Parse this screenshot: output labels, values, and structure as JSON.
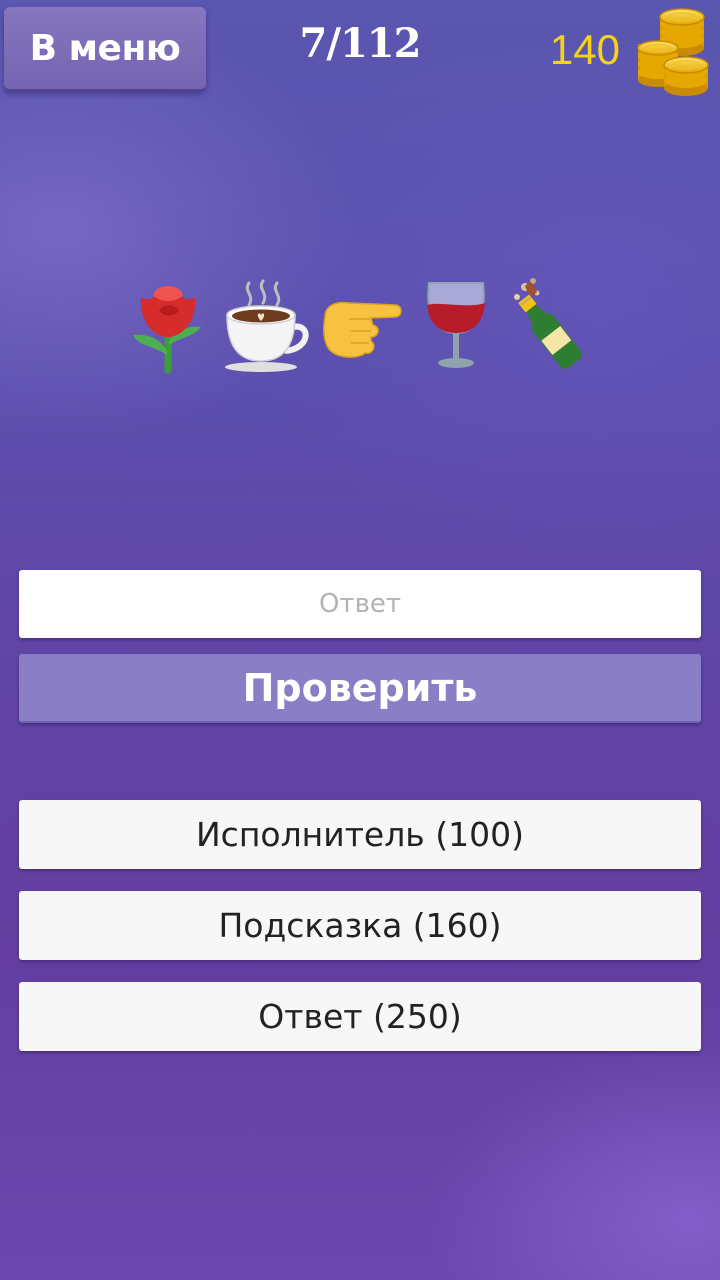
{
  "header": {
    "menu_label": "В меню",
    "level_progress": "7/112",
    "coins": "140",
    "coins_icon": "gold-coins-icon"
  },
  "puzzle": {
    "emojis": [
      "rose",
      "hot-beverage",
      "pointing-right",
      "wine-glass",
      "champagne-bottle"
    ]
  },
  "answer": {
    "placeholder": "Ответ",
    "value": ""
  },
  "check_label": "Проверить",
  "hints": [
    {
      "label": "Исполнитель (100)"
    },
    {
      "label": "Подсказка (160)"
    },
    {
      "label": "Ответ (250)"
    }
  ],
  "colors": {
    "accent_gold": "#f7d21b",
    "button_purple": "#8a7fc6",
    "menu_purple": "#7d6dba"
  }
}
